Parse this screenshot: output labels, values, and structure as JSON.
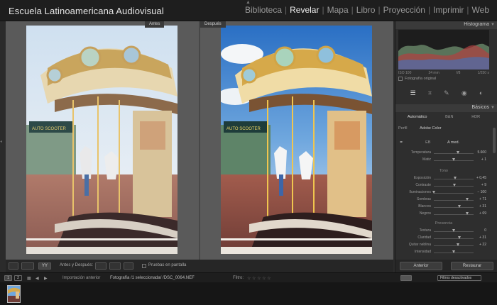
{
  "app": {
    "brand": "Escuela Latinoamericana Audiovisual",
    "modules": [
      "Biblioteca",
      "Revelar",
      "Mapa",
      "Libro",
      "Proyección",
      "Imprimir",
      "Web"
    ],
    "active_module": "Revelar"
  },
  "view": {
    "before_label": "Antes",
    "after_label": "Después"
  },
  "toolbar": {
    "view_mode_label": "YY",
    "before_after_label": "Antes y Después:",
    "soft_proof_label": "Pruebas en pantalla"
  },
  "right_panel": {
    "histogram_title": "Histograma",
    "histogram_footer": [
      "ISO 100",
      "24 mm",
      "f/8",
      "1/250 s"
    ],
    "original_photo_label": "Fotografía original",
    "basic_title": "Básicos",
    "treatment": [
      "Automático",
      "B&N",
      "HDR"
    ],
    "profile_label": "Perfil",
    "profile_value": "Adobe Color",
    "wb_label": "EB",
    "wb_value": "A med.",
    "sliders_wb": [
      {
        "label": "Temperatura",
        "value": "5.600",
        "pos": 0.62
      },
      {
        "label": "Matiz",
        "value": "+ 1",
        "pos": 0.5
      }
    ],
    "tone_label": "Tono",
    "sliders_tone": [
      {
        "label": "Exposición",
        "value": "+ 0,45",
        "pos": 0.55
      },
      {
        "label": "Contraste",
        "value": "+ 9",
        "pos": 0.53
      },
      {
        "label": "Iluminaciones",
        "value": "− 100",
        "pos": 0.0
      },
      {
        "label": "Sombras",
        "value": "+ 71",
        "pos": 0.85
      },
      {
        "label": "Blancos",
        "value": "+ 31",
        "pos": 0.65
      },
      {
        "label": "Negros",
        "value": "+ 69",
        "pos": 0.84
      }
    ],
    "presence_label": "Presencia",
    "sliders_presence": [
      {
        "label": "Textura",
        "value": "0",
        "pos": 0.5
      },
      {
        "label": "Claridad",
        "value": "+ 31",
        "pos": 0.65
      },
      {
        "label": "Quitar neblina",
        "value": "+ 22",
        "pos": 0.61
      },
      {
        "label": "Intensidad",
        "value": "",
        "pos": 0.5
      }
    ],
    "prev_button": "Anterior",
    "reset_button": "Restaurar"
  },
  "filmstrip": {
    "page_1": "1",
    "page_2": "2",
    "import_label": "Importación anterior",
    "photo_info": "Fotografía /1 seleccionada/ /DSC_0064.NEF",
    "filter_label": "Filtro:",
    "filter_value": "Filtros desactivados"
  },
  "colors": {
    "accent": "#f0f0f0",
    "panel_bg": "#2e2e2e",
    "work_bg": "#474747"
  }
}
